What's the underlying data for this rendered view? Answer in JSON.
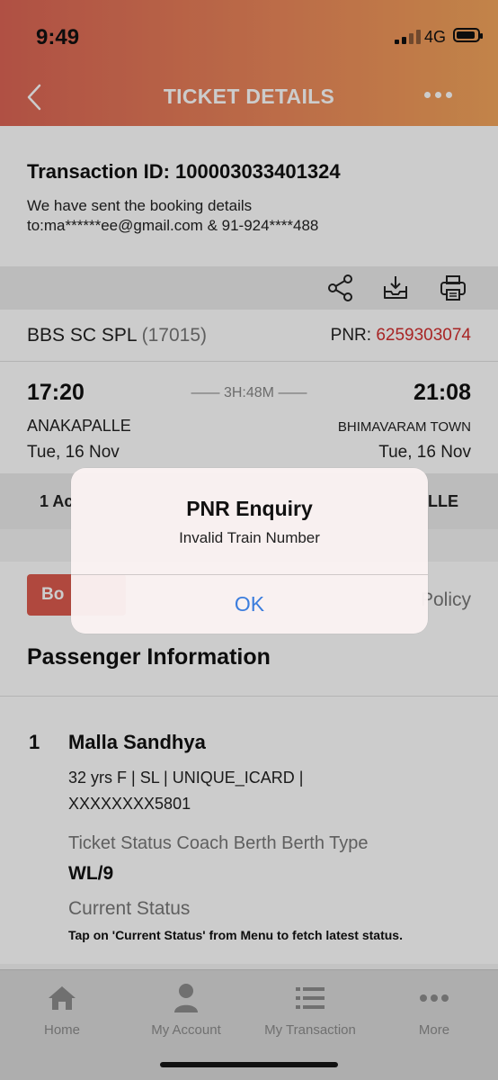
{
  "status": {
    "time": "9:49",
    "network": "4G"
  },
  "header": {
    "title": "TICKET DETAILS"
  },
  "transaction": {
    "id_label": "Transaction ID: 100003033401324",
    "note_line1": "We have sent the booking details",
    "note_line2": "to:ma******ee@gmail.com & 91-924****488"
  },
  "train": {
    "name": "BBS SC SPL",
    "number": "(17015)",
    "pnr_label": "PNR: ",
    "pnr": "6259303074"
  },
  "journey": {
    "dep_time": "17:20",
    "arr_time": "21:08",
    "duration": "—— 3H:48M ——",
    "from": "ANAKAPALLE",
    "to": "BHIMAVARAM TOWN",
    "dep_date": "Tue, 16 Nov",
    "arr_date": "Tue, 16 Nov"
  },
  "class_row": {
    "left": "1 Ac",
    "right": "LLE"
  },
  "book_row": {
    "button": "Bo",
    "link": "Policy"
  },
  "passenger_section": {
    "title": "Passenger Information"
  },
  "passenger": {
    "num": "1",
    "name": "Malla Sandhya",
    "info_line1": "32 yrs F | SL | UNIQUE_ICARD |",
    "info_line2": "XXXXXXXX5801",
    "columns": "Ticket Status Coach   Berth    Berth Type",
    "status": "WL/9",
    "current_label": "Current Status",
    "current_hint": "Tap on 'Current Status' from Menu to fetch latest status."
  },
  "alert": {
    "title": "PNR Enquiry",
    "message": "Invalid Train Number",
    "ok": "OK"
  },
  "tabs": [
    {
      "label": "Home",
      "icon": "home-icon"
    },
    {
      "label": "My Account",
      "icon": "user-icon"
    },
    {
      "label": "My Transaction",
      "icon": "list-icon"
    },
    {
      "label": "More",
      "icon": "more-icon"
    }
  ],
  "colors": {
    "header_start": "#dc6556",
    "header_end": "#f3a55c",
    "pnr": "#d32f2f",
    "alert_button": "#3b7ddd"
  }
}
